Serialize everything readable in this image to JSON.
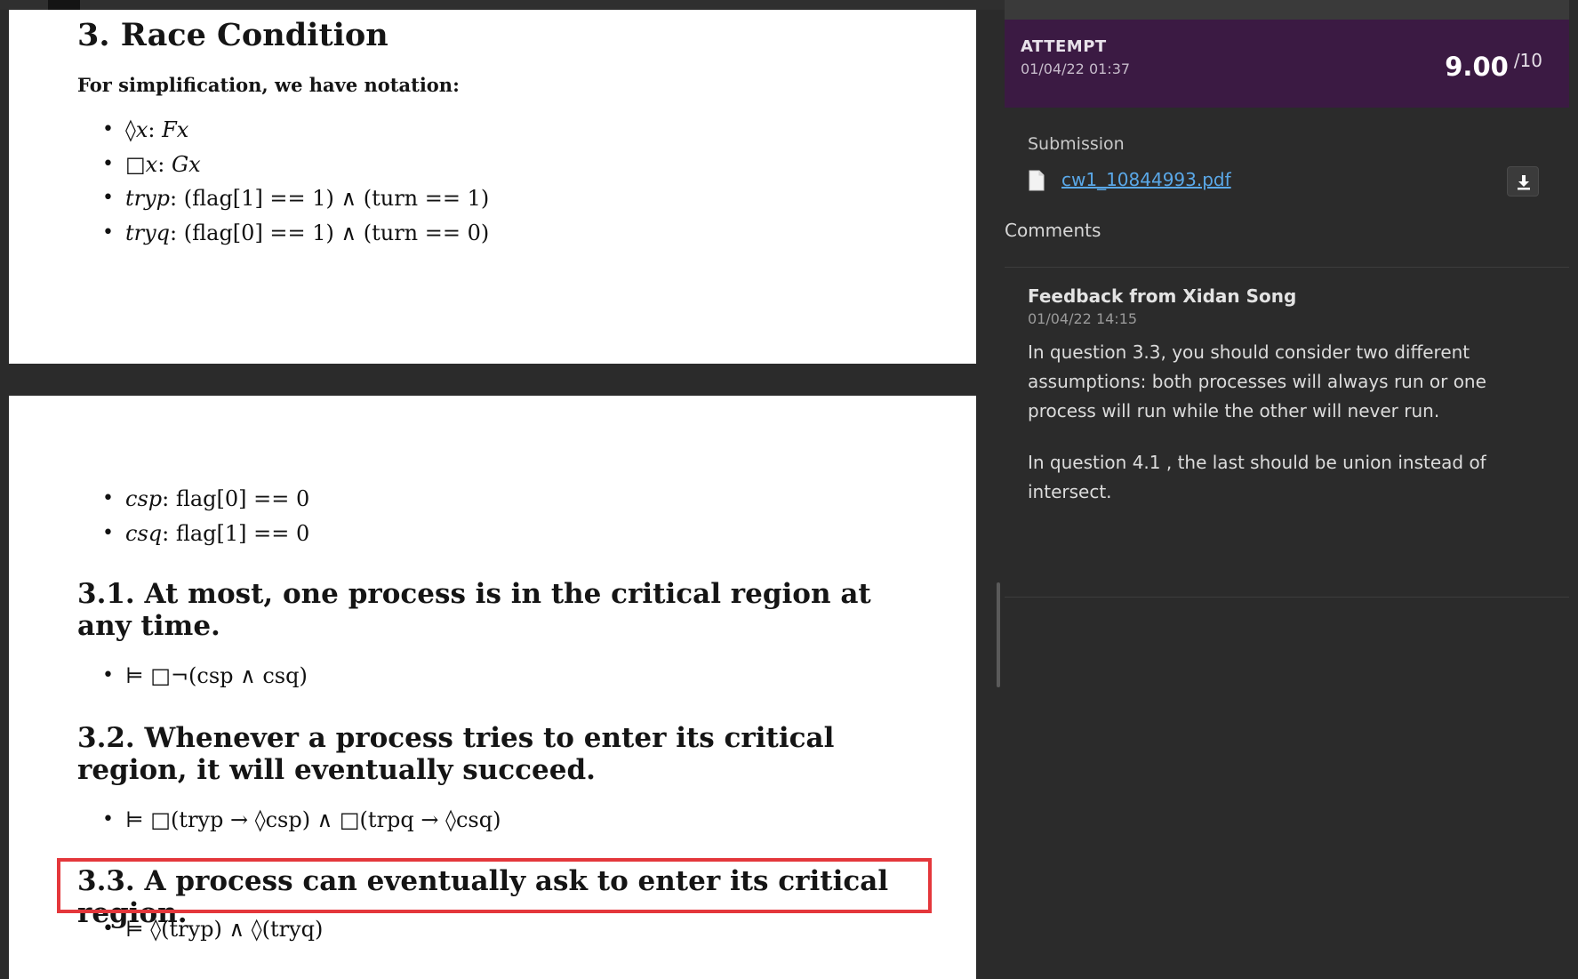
{
  "document": {
    "page1": {
      "heading": "3. Race Condition",
      "notation_intro": "For simplification, we have notation:",
      "notation_items": [
        {
          "lhs": "◊x",
          "rhs": "Fx"
        },
        {
          "lhs": "□x",
          "rhs": "Gx"
        },
        {
          "lhs": "tryp",
          "rhs": "(flag[1] == 1) ∧ (turn == 1)"
        },
        {
          "lhs": "tryq",
          "rhs": "(flag[0] == 1) ∧ (turn == 0)"
        }
      ]
    },
    "page2": {
      "notation_items": [
        {
          "lhs": "csp",
          "rhs": "flag[0] == 0"
        },
        {
          "lhs": "csq",
          "rhs": "flag[1] == 0"
        }
      ],
      "q31_heading": "3.1. At most, one process is in the critical region at any time.",
      "q31_formula": "⊨ □¬(csp ∧ csq)",
      "q32_heading": "3.2. Whenever a process tries to enter its critical region, it will eventually succeed.",
      "q32_formula": "⊨ □(tryp → ◊csp) ∧ □(trpq → ◊csq)",
      "q33_heading": "3.3. A process can eventually ask to enter its critical region.",
      "q33_formula": "⊨ ◊(tryp) ∧ ◊(tryq)"
    },
    "highlight_color": "#e4373b"
  },
  "attempt": {
    "label": "ATTEMPT",
    "date": "01/04/22 01:37",
    "score": "9.00",
    "score_max": "/10",
    "banner_color": "#3b1a43"
  },
  "submission": {
    "label": "Submission",
    "file_name": "cw1_10844993.pdf",
    "file_icon": "document-icon",
    "download_icon": "download-icon"
  },
  "comments": {
    "label": "Comments",
    "feedback_title": "Feedback from Xidan Song",
    "feedback_date": "01/04/22 14:15",
    "paragraphs": [
      "In question 3.3, you should consider two different assumptions: both processes will always run or one process will run while the other will never run.",
      "In question 4.1 , the last should be union instead of intersect."
    ]
  },
  "colors": {
    "link": "#5aa8e8",
    "panel_bg": "#2b2b2b"
  }
}
